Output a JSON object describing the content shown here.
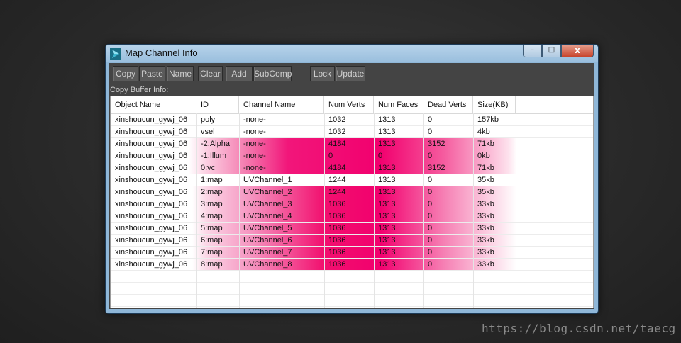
{
  "window": {
    "title": "Map Channel Info",
    "controls": {
      "minimize": "–",
      "maximize": "□",
      "close": "x"
    }
  },
  "toolbar": {
    "buttons": [
      "Copy",
      "Paste",
      "Name",
      "Clear",
      "Add",
      "SubComp",
      "Lock",
      "Update"
    ]
  },
  "buffer_label": "Copy Buffer Info:",
  "table": {
    "columns": [
      "Object Name",
      "ID",
      "Channel Name",
      "Num Verts",
      "Num Faces",
      "Dead Verts",
      "Size(KB)"
    ],
    "rows": [
      [
        "xinshoucun_gywj_06",
        "poly",
        "-none-",
        "1032",
        "1313",
        "0",
        "157kb"
      ],
      [
        "xinshoucun_gywj_06",
        "vsel",
        "-none-",
        "1032",
        "1313",
        "0",
        "4kb"
      ],
      [
        "xinshoucun_gywj_06",
        "-2:Alpha",
        "-none-",
        "4184",
        "1313",
        "3152",
        "71kb"
      ],
      [
        "xinshoucun_gywj_06",
        "-1:Illum",
        "-none-",
        "0",
        "0",
        "0",
        "0kb"
      ],
      [
        "xinshoucun_gywj_06",
        "0:vc",
        "-none-",
        "4184",
        "1313",
        "3152",
        "71kb"
      ],
      [
        "xinshoucun_gywj_06",
        "1:map",
        "UVChannel_1",
        "1244",
        "1313",
        "0",
        "35kb"
      ],
      [
        "xinshoucun_gywj_06",
        "2:map",
        "UVChannel_2",
        "1244",
        "1313",
        "0",
        "35kb"
      ],
      [
        "xinshoucun_gywj_06",
        "3:map",
        "UVChannel_3",
        "1036",
        "1313",
        "0",
        "33kb"
      ],
      [
        "xinshoucun_gywj_06",
        "4:map",
        "UVChannel_4",
        "1036",
        "1313",
        "0",
        "33kb"
      ],
      [
        "xinshoucun_gywj_06",
        "5:map",
        "UVChannel_5",
        "1036",
        "1313",
        "0",
        "33kb"
      ],
      [
        "xinshoucun_gywj_06",
        "6:map",
        "UVChannel_6",
        "1036",
        "1313",
        "0",
        "33kb"
      ],
      [
        "xinshoucun_gywj_06",
        "7:map",
        "UVChannel_7",
        "1036",
        "1313",
        "0",
        "33kb"
      ],
      [
        "xinshoucun_gywj_06",
        "8:map",
        "UVChannel_8",
        "1036",
        "1313",
        "0",
        "33kb"
      ]
    ],
    "highlighted_rows": [
      2,
      3,
      4,
      6,
      7,
      8,
      9,
      10,
      11,
      12
    ],
    "highlight_color": "#f2006e"
  },
  "watermark": "https://blog.csdn.net/taecg",
  "colors": {
    "frame": "#8fb7d8",
    "client_bg": "#444444",
    "button_bg": "#5a5a5a",
    "button_text": "#cfcfcf"
  },
  "icons": {
    "app": "3dsmax-logo-icon"
  }
}
